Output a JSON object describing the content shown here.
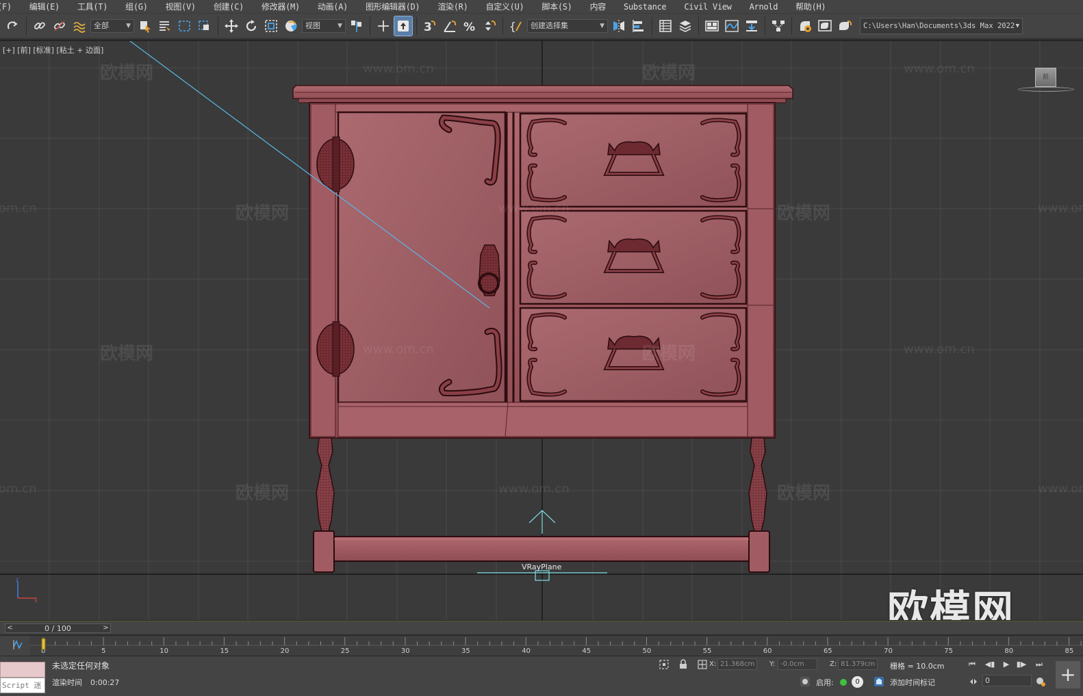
{
  "menu": {
    "items": [
      "(F)",
      "编辑(E)",
      "工具(T)",
      "组(G)",
      "视图(V)",
      "创建(C)",
      "修改器(M)",
      "动画(A)",
      "图形编辑器(D)",
      "渲染(R)",
      "自定义(U)",
      "脚本(S)",
      "内容",
      "Substance",
      "Civil View",
      "Arnold",
      "帮助(H)"
    ]
  },
  "toolbar": {
    "selection_filter": "全部",
    "ref_coord": "视图",
    "named_selection": "创建选择集",
    "project_path": "C:\\Users\\Han\\Documents\\3ds Max 2022"
  },
  "viewport": {
    "label": "[+] [前] [标准] [粘土 + 边面]",
    "viewcube_label": "前",
    "object_label": "VRayPlane",
    "axis_z": "z",
    "axis_x": "x",
    "watermark_text": "欧模网",
    "watermark_url": "www.om.cn",
    "watermark_url_short": "om.cn",
    "brand_watermark": "欧模网",
    "model_color": "#a0595f",
    "background_color": "#3a3a3a"
  },
  "timeline": {
    "frame_display": "0 / 100",
    "prev_symbol": "<",
    "next_symbol": ">",
    "ticks": [
      "0",
      "5",
      "10",
      "15",
      "20",
      "25",
      "30",
      "35",
      "40",
      "45",
      "50",
      "55",
      "60",
      "65",
      "70",
      "75",
      "80",
      "85"
    ]
  },
  "status": {
    "script_label": "Script 迷",
    "message": "未选定任何对象",
    "render_time_label": "渲染时间",
    "render_time": "0:00:27",
    "x_label": "X:",
    "x_value": "21.368cm",
    "y_label": "Y:",
    "y_value": "-0.0cm",
    "z_label": "Z:",
    "z_value": "81.379cm",
    "grid": "栅格 = 10.0cm",
    "enable_label": "启用:",
    "enable_count": "0",
    "add_time_tag": "添加时间标记",
    "current_frame": "0",
    "enable_dot_color": "#3ec23e"
  }
}
